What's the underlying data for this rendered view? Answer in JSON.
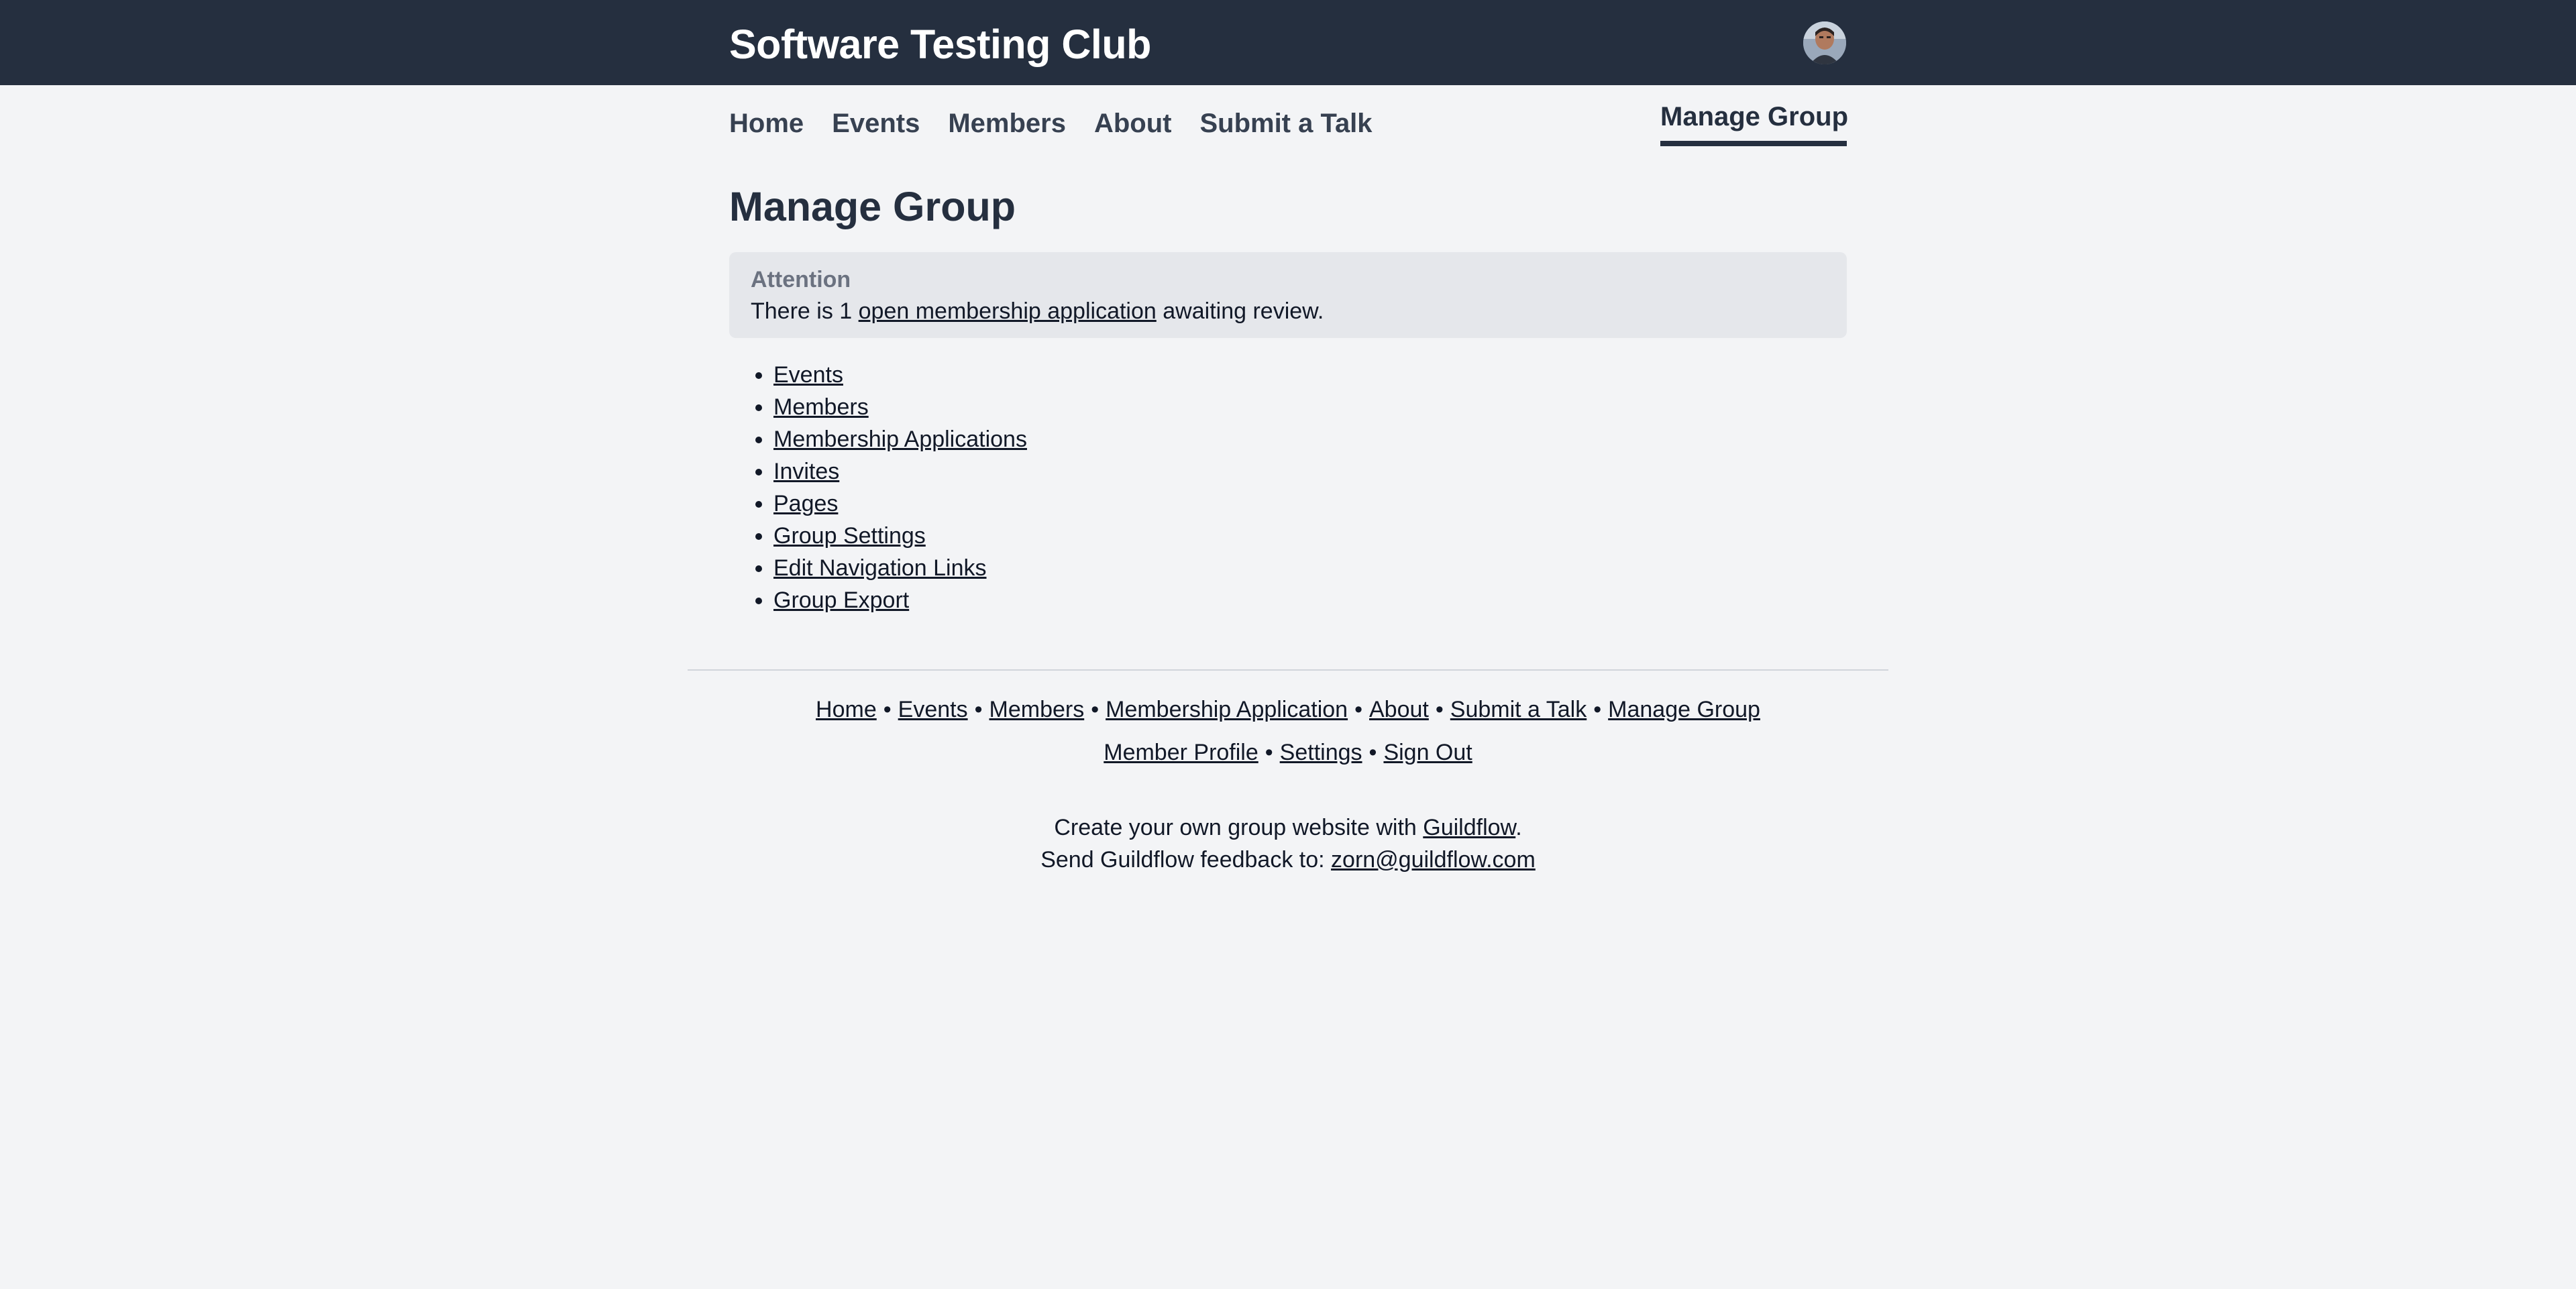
{
  "header": {
    "site_title": "Software Testing Club",
    "avatar_icon": "user-avatar"
  },
  "nav": {
    "items": [
      "Home",
      "Events",
      "Members",
      "About",
      "Submit a Talk"
    ],
    "active": "Manage Group"
  },
  "page": {
    "title": "Manage Group"
  },
  "alert": {
    "title": "Attention",
    "text_before": "There is 1",
    "link": "open membership application",
    "text_after": "awaiting review."
  },
  "admin_links": [
    "Events",
    "Members",
    "Membership Applications",
    "Invites",
    "Pages",
    "Group Settings",
    "Edit Navigation Links",
    "Group Export"
  ],
  "footer": {
    "row1": [
      "Home",
      "Events",
      "Members",
      "Membership Application",
      "About",
      "Submit a Talk",
      "Manage Group"
    ],
    "row2": [
      "Member Profile",
      "Settings",
      "Sign Out"
    ],
    "separator": "•",
    "create_text": "Create your own group website with",
    "create_link": "Guildflow",
    "create_end": ".",
    "feedback_text": "Send Guildflow feedback to:",
    "feedback_email": "zorn@guildflow.com"
  },
  "colors": {
    "header_bg": "#252f3f",
    "page_bg": "#f3f4f6",
    "alert_bg": "#e5e7eb"
  }
}
